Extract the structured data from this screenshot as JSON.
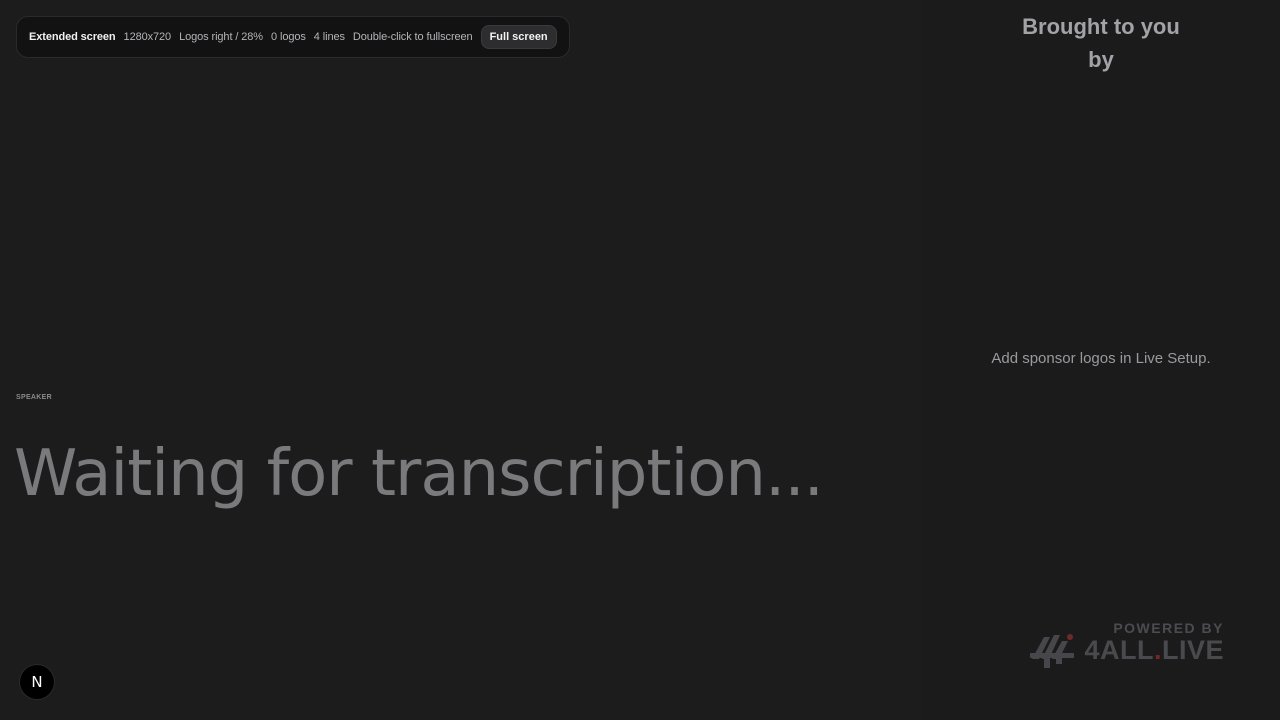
{
  "toolbar": {
    "title": "Extended screen",
    "resolution": "1280x720",
    "logos_position": "Logos right / 28%",
    "logos_count": "0 logos",
    "lines": "4 lines",
    "hint": "Double-click to fullscreen",
    "fullscreen_button": "Full screen"
  },
  "main": {
    "speaker_label": "SPEAKER",
    "transcript_placeholder": "Waiting for transcription..."
  },
  "sponsors": {
    "heading_line1": "Brought to you",
    "heading_line2": "by",
    "empty_hint": "Add sponsor logos in Live Setup.",
    "powered_by": "POWERED BY",
    "brand_prefix": "4ALL",
    "brand_dot": ".",
    "brand_suffix": "LIVE"
  },
  "corner_button": {
    "letter": "N"
  },
  "colors": {
    "background": "#1c1c1d",
    "toolbar": "#121213",
    "transcript": "#7a7a7d",
    "brand_dot": "#7a2424"
  }
}
